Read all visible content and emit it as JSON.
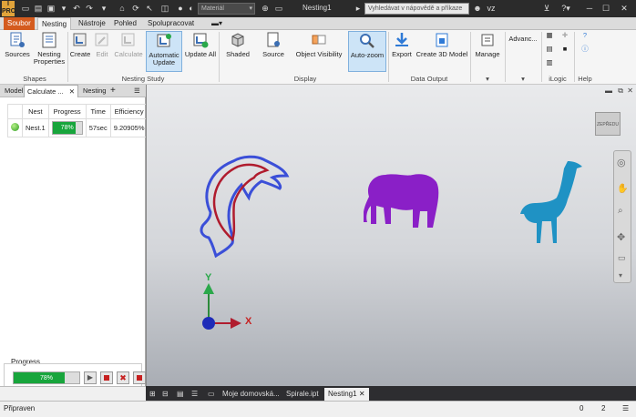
{
  "titlebar": {
    "app_icon_label": "I PRO",
    "material": "Materiál",
    "document_title": "Nesting1",
    "help_search_placeholder": "Vyhledávat v nápovědě a příkaze",
    "user": "vz"
  },
  "menu_tabs": [
    "Soubor",
    "Nesting",
    "Nástroje",
    "Pohled",
    "Spolupracovat"
  ],
  "ribbon": {
    "shapes": {
      "label": "Shapes",
      "buttons": [
        "Sources",
        "Nesting Properties"
      ]
    },
    "nesting_study": {
      "label": "Nesting Study",
      "buttons": [
        "Create",
        "Edit",
        "Calculate",
        "Automatic Update",
        "Update All"
      ]
    },
    "display": {
      "label": "Display",
      "buttons": [
        "Shaded",
        "Source",
        "Object Visibility",
        "Auto-zoom"
      ]
    },
    "data_output": {
      "label": "Data Output",
      "buttons": [
        "Export",
        "Create 3D Model"
      ]
    },
    "manage": {
      "label": "",
      "buttons": [
        "Manage"
      ]
    },
    "advanced": {
      "label": "",
      "buttons": [
        "Advanc..."
      ]
    },
    "ilogic": {
      "label": "iLogic"
    },
    "help": {
      "label": "Help"
    }
  },
  "panel_tabs": [
    "Model",
    "Calculate ...",
    "Nesting"
  ],
  "nest_table": {
    "headers": [
      "Nest",
      "Progress",
      "Time",
      "Efficiency"
    ],
    "rows": [
      {
        "name": "Nest.1",
        "progress_label": "78%",
        "progress": 78,
        "time": "57sec",
        "efficiency": "9.20905%"
      }
    ]
  },
  "progress_section": {
    "title": "Progress",
    "label": "78%",
    "value": 78
  },
  "viewcube_label": "ZEPŘEDU",
  "axes": {
    "x": "X",
    "y": "Y"
  },
  "document_tabs": [
    "Moje domovská...",
    "Spirale.ipt",
    "Nesting1"
  ],
  "status": {
    "text": "Připraven",
    "count_a": "0",
    "count_b": "2"
  },
  "colors": {
    "accent": "#d45b1e",
    "progress_fill": "#18a53c",
    "dolphin": "#3b4fd8",
    "dolphin_inner": "#b01c2e",
    "elephant": "#8a1fc7",
    "giraffe": "#1f92c4"
  }
}
